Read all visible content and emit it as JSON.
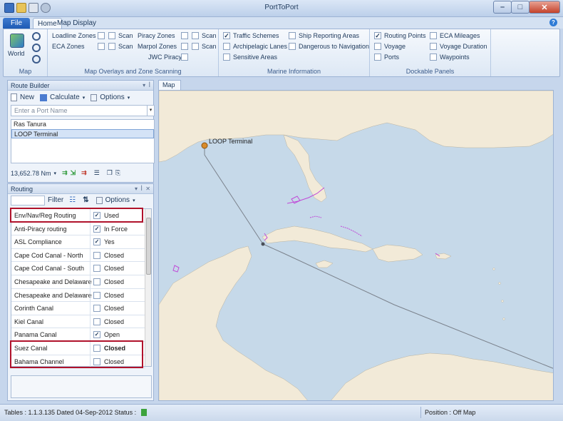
{
  "window": {
    "title": "PortToPort"
  },
  "tabs": [
    "File",
    "Home",
    "Map Display"
  ],
  "ribbon": {
    "map": {
      "world_label": "World",
      "group_label": "Map"
    },
    "overlays": {
      "group_label": "Map Overlays and Zone Scanning",
      "loadline_zones": "Loadline Zones",
      "eca_zones": "ECA Zones",
      "piracy_zones": "Piracy Zones",
      "marpol_zones": "Marpol Zones",
      "jwc_piracy": "JWC Piracy",
      "scan": "Scan"
    },
    "marine": {
      "group_label": "Marine Information",
      "traffic_schemes": "Traffic Schemes",
      "archipelagic_lanes": "Archipelagic Lanes",
      "sensitive_areas": "Sensitive Areas",
      "ship_reporting_areas": "Ship Reporting Areas",
      "dangerous_to_navigation": "Dangerous to Navigation"
    },
    "dockable": {
      "group_label": "Dockable Panels",
      "routing_points": "Routing Points",
      "voyage": "Voyage",
      "ports": "Ports",
      "eca_mileages": "ECA Mileages",
      "voyage_duration": "Voyage Duration",
      "waypoints": "Waypoints"
    }
  },
  "route_builder": {
    "title": "Route Builder",
    "new_label": "New",
    "calculate_label": "Calculate",
    "options_label": "Options",
    "port_placeholder": "Enter a Port Name",
    "ports": [
      "Ras Tanura",
      "LOOP Terminal"
    ],
    "distance": "13,652.78 Nm"
  },
  "routing": {
    "title": "Routing",
    "filter_label": "Filter",
    "options_label": "Options",
    "rows": [
      {
        "name": "Env/Nav/Reg Routing",
        "checked": true,
        "value": "Used"
      },
      {
        "name": "Anti-Piracy routing",
        "checked": true,
        "value": "In Force"
      },
      {
        "name": "ASL Compliance",
        "checked": true,
        "value": "Yes"
      },
      {
        "name": "Cape Cod Canal - North",
        "checked": false,
        "value": "Closed"
      },
      {
        "name": "Cape Cod Canal - South",
        "checked": false,
        "value": "Closed"
      },
      {
        "name": "Chesapeake and Delaware",
        "checked": false,
        "value": "Closed"
      },
      {
        "name": "Chesapeake and Delaware",
        "checked": false,
        "value": "Closed"
      },
      {
        "name": "Corinth Canal",
        "checked": false,
        "value": "Closed"
      },
      {
        "name": "Kiel Canal",
        "checked": false,
        "value": "Closed"
      },
      {
        "name": "Panama Canal",
        "checked": true,
        "value": "Open"
      },
      {
        "name": "Suez Canal",
        "checked": false,
        "value": "Closed",
        "bold": true
      },
      {
        "name": "Bahama Channel",
        "checked": false,
        "value": "Closed"
      }
    ]
  },
  "map": {
    "tab_label": "Map",
    "port_label": "LOOP Terminal"
  },
  "status": {
    "tables": "Tables : 1.1.3.135 Dated 04-Sep-2012  Status :",
    "position": "Position :  Off Map"
  }
}
